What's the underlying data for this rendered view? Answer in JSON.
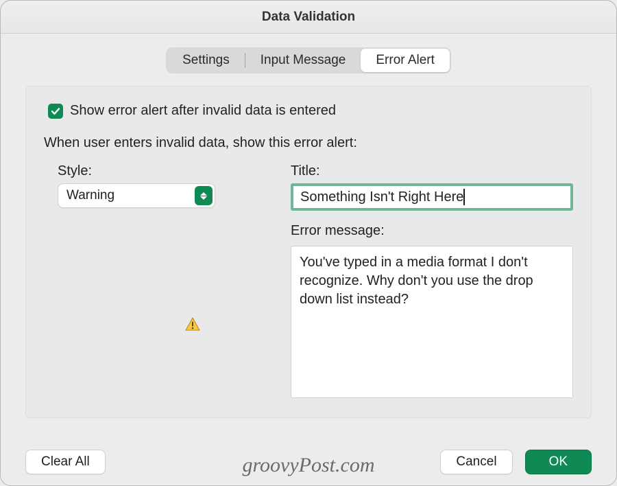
{
  "window": {
    "title": "Data Validation"
  },
  "tabs": {
    "settings": "Settings",
    "input_message": "Input Message",
    "error_alert": "Error Alert",
    "active": "error_alert"
  },
  "checkbox": {
    "checked": true,
    "label": "Show error alert after invalid data is entered"
  },
  "instruction": "When user enters invalid data, show this error alert:",
  "style": {
    "label": "Style:",
    "value": "Warning"
  },
  "title_field": {
    "label": "Title:",
    "value": "Something Isn't Right Here"
  },
  "error_message": {
    "label": "Error message:",
    "value": "You've typed in a media format I don't recognize. Why don't you use the drop down list instead?"
  },
  "buttons": {
    "clear_all": "Clear All",
    "cancel": "Cancel",
    "ok": "OK"
  },
  "watermark": "groovyPost.com"
}
